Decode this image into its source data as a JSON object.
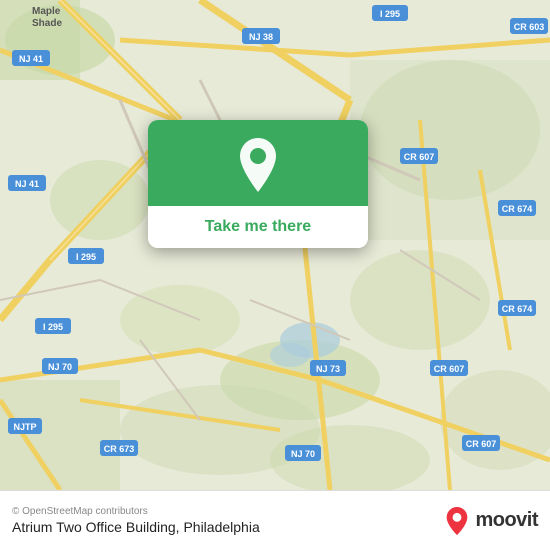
{
  "map": {
    "attribution": "© OpenStreetMap contributors",
    "background_color": "#e8e0d8"
  },
  "popup": {
    "button_label": "Take me there",
    "pin_color": "#ffffff",
    "background_color": "#3aaa5e"
  },
  "bottom_bar": {
    "place_name": "Atrium Two Office Building, Philadelphia",
    "attribution": "© OpenStreetMap contributors",
    "moovit_text": "moovit"
  },
  "road_labels": [
    "NJ 41",
    "NJ 41",
    "NJ 38",
    "I 295",
    "CR 603",
    "I 295",
    "CR 607",
    "CR 674",
    "I 295",
    "CR 674",
    "NJ 70",
    "NJ 73",
    "CR 607",
    "NJTP",
    "CR 673",
    "NJ 70",
    "CR 607"
  ]
}
